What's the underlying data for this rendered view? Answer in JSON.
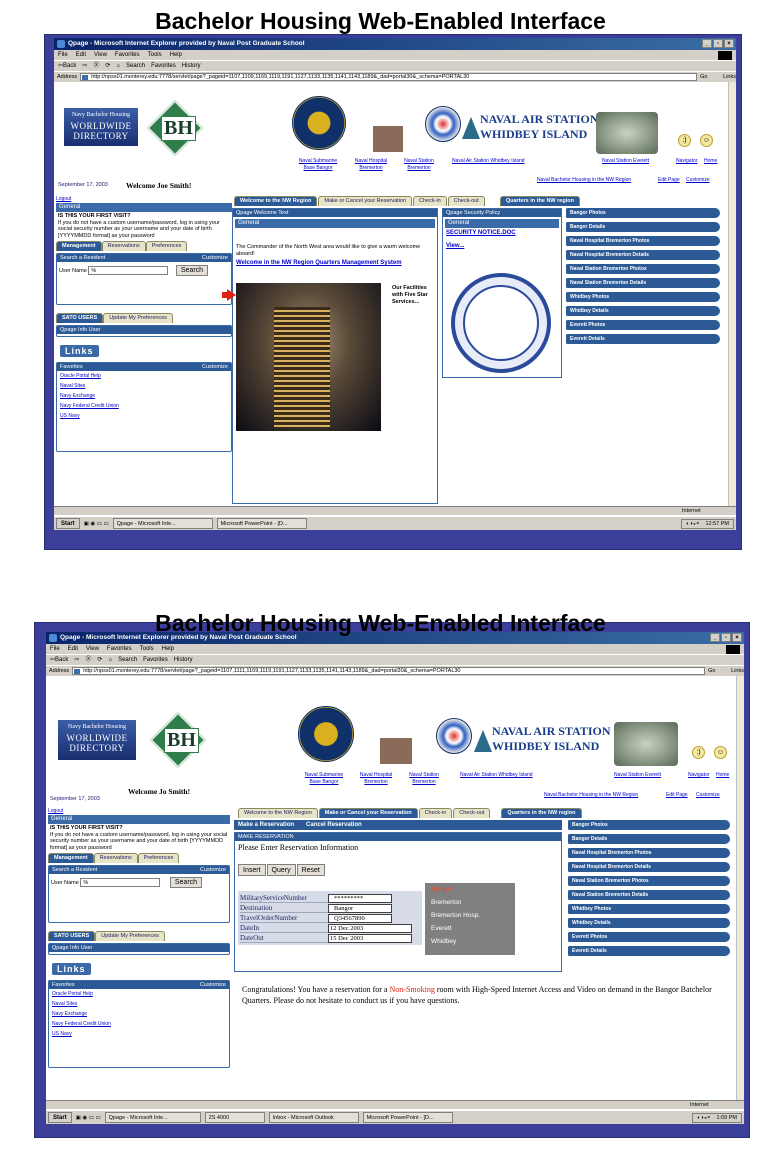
{
  "slides": [
    {
      "title": "Bachelor Housing Web-Enabled Interface",
      "window_title": "Qpage - Microsoft Internet Explorer provided by Naval Post Graduate School",
      "menu": [
        "File",
        "Edit",
        "View",
        "Favorites",
        "Tools",
        "Help"
      ],
      "toolbar": [
        "⇦Back",
        "⇨",
        "Ⓧ",
        "⟳",
        "⌂",
        "Search",
        "Favorites",
        "History"
      ],
      "address_label": "Address",
      "address": "http://npss01.monterey.edu:7778/servlet/page?_pageid=1107,1109,1169,1119,1191,1127,1133,1135,1141,1143,1189&_dad=portal30&_schema=PORTAL30",
      "go": "Go",
      "links": "Links",
      "worldwide": "WORLDWIDE DIRECTORY",
      "worldwide_small": "Navy Bachelor Housing",
      "bh": "BH",
      "nas_line1": "NAVAL AIR STATION",
      "nas_line2": "WHIDBEY ISLAND",
      "top_links": [
        "Naval Submarine Base Bangor",
        "Naval Hospital Bremerton",
        "Naval Station Bremerton",
        "Naval Air Station Whidbey Island",
        "Naval Station Everett",
        "Navigator",
        "Home"
      ],
      "sub_links": [
        "Naval Bachelor Housing in the NW Region",
        "Edit Page",
        "Customize"
      ],
      "date": "September 17, 2003",
      "welcome": "Welcome Joe Smith!",
      "logout": "Logout",
      "general": "General",
      "first_visit_head": "IS THIS YOUR FIRST VISIT?",
      "first_visit_text": "If you do not have a custom username/password, log in using your social security number as your username and your date of birth [YYYYMMDD format] as your password",
      "side_tabs": [
        "Management",
        "Reservations",
        "Preferences"
      ],
      "search_head": "Search a Resident",
      "customize": "Customize",
      "user_name_label": "User Name",
      "user_name_value": "%",
      "search_btn": "Search",
      "sato_tabs": [
        "SATO USERS",
        "Update My Preferences"
      ],
      "qpage_info": "Qpage Info User",
      "links_logo": "Links",
      "favorites": "Favorites",
      "fav_items": [
        "Oracle Portal Help",
        "Naval Sites",
        "Navy Exchange",
        "Navy Federal Credit Union",
        "US Navy"
      ],
      "main_tabs": [
        "Welcome to the NW Region",
        "Make or Cancel your Reservation",
        "Check-in",
        "Check-out",
        "Quarters in the NW region"
      ],
      "welcome_panel_head": "Qpage Welcome Text",
      "welcome_general": "General",
      "welcome_msg": "The Commander of the North West area would like to give a warm welcome aboard!",
      "welcome_link": "Welcome in the NW Region Quarters Management System",
      "facilities": "Our Facilities with Five Star Services...",
      "security_head": "Qpage Security Policy",
      "security_general": "General",
      "security_link": "SECURITY NOTICE.DOC",
      "view": "View...",
      "region_links": [
        "Bangor Photos",
        "Bangor Details",
        "Naval Hospital Bremerton Photos",
        "Naval Hospital Bremerton Details",
        "Naval Station Bremerton Photos",
        "Naval Station Bremerton Details",
        "Whidbey Photos",
        "Whidbey Details",
        "Everett Photos",
        "Everett Details"
      ],
      "status": "",
      "zone": "Internet",
      "start": "Start",
      "task_buttons": [
        "Qpage - Microsoft Inte...",
        "Microsoft PowerPoint - [D..."
      ],
      "clock": "12:57 PM"
    },
    {
      "title": "Bachelor Housing Web-Enabled Interface",
      "window_title": "Qpage - Microsoft Internet Explorer provided by Naval Post Graduate School",
      "address": "http://npss01.monterey.edu:7778/servlet/page?_pageid=1107,1111,1169,1119,1191,1127,1133,1135,1141,1143,1189&_dad=portal30&_schema=PORTAL30",
      "date": "September 17, 2003",
      "welcome": "Welcome Jo Smith!",
      "main_tabs": [
        "Welcome to the NW Region",
        "Make or Cancel your Reservation",
        "Check-in",
        "Check-out",
        "Quarters in the NW region"
      ],
      "sub_tabs": [
        "Make a Reservation",
        "Cancel Reservation"
      ],
      "make_res_head": "MAKE RESERVATION",
      "make_res_title": "Please Enter Reservation Information",
      "form_buttons": [
        "Insert",
        "Query",
        "Reset"
      ],
      "fields": [
        {
          "label": "MilitaryServiceNumber",
          "value": "*********"
        },
        {
          "label": "Destination",
          "value": "Bangor"
        },
        {
          "label": "TravelOrderNumber",
          "value": "Q34567890"
        },
        {
          "label": "DateIn",
          "value": "12 Dec 2003"
        },
        {
          "label": "DateOut",
          "value": "15 Dec 2003"
        }
      ],
      "dropdown": [
        "Bangor",
        "Bremerton",
        "Bremerton Hosp.",
        "Everett",
        "Whidbey"
      ],
      "congrats_pre": "Congratulations! You have a reservation for a ",
      "congrats_red": "Non-Smoking",
      "congrats_post": " room with High-Speed Internet Access and Video on demand in the Bangor Batchelor Quarters.  Please do not hesitate to conduct us if you have questions.",
      "task_buttons": [
        "Qpage - Microsoft Inte...",
        "2S 4000",
        "Inbox - Microsoft Outlook",
        "Microsoft PowerPoint - [D..."
      ],
      "clock": "1:09 PM"
    }
  ],
  "colors": {
    "frame": "#3b3f9a",
    "portal_blue": "#2c5a96",
    "link": "#0000cc",
    "arrow": "#e02010",
    "dropdown": "#808080"
  }
}
